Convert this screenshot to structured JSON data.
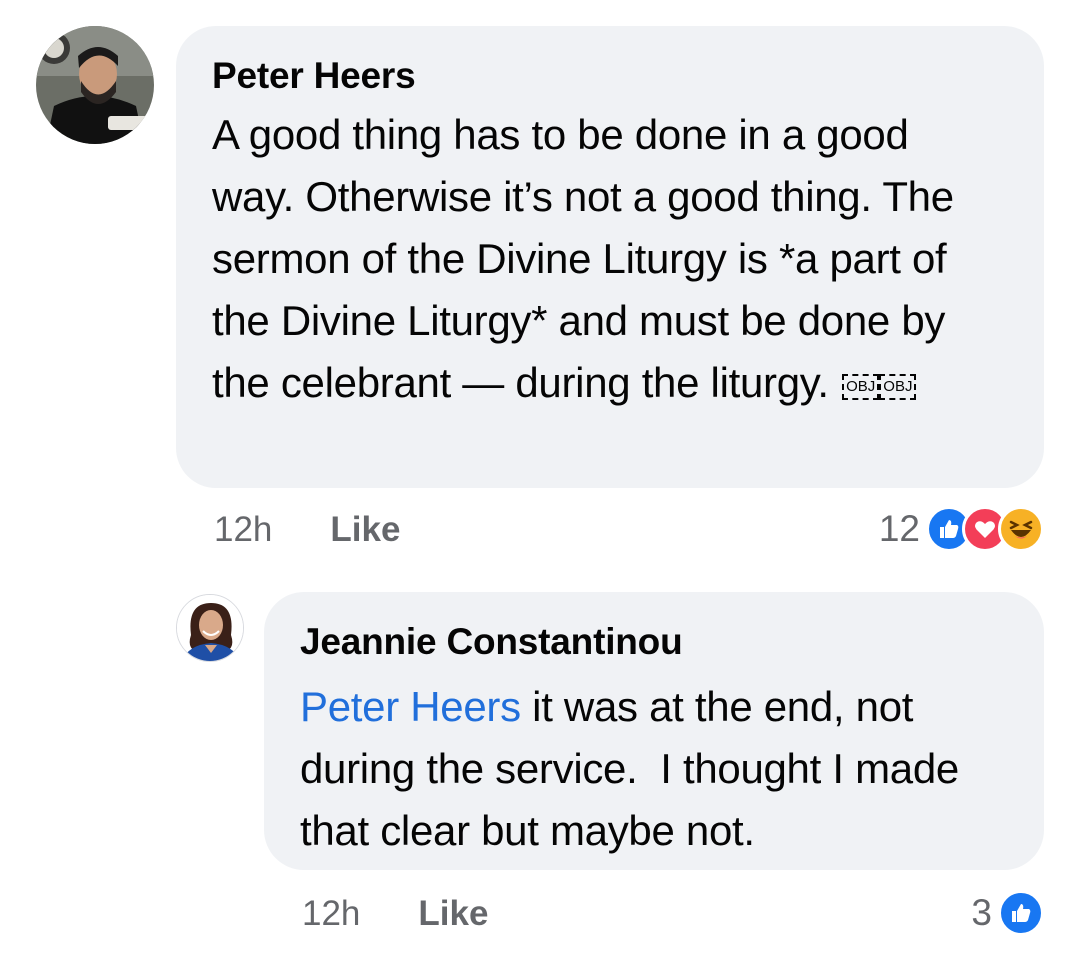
{
  "comments": [
    {
      "author": "Peter Heers",
      "text": "A good thing has to be done in a good way. Otherwise it’s not a good thing. The sermon of the Divine Liturgy is *a part of the Divine Liturgy* and must be done by the celebrant — during the liturgy.",
      "obj_placeholders": [
        "OBJ",
        "OBJ"
      ],
      "time": "12h",
      "like_label": "Like",
      "reaction_count": "12",
      "reactions": [
        "like-icon",
        "love-icon",
        "haha-icon"
      ]
    },
    {
      "author": "Jeannie Constantinou",
      "mention": "Peter Heers",
      "text": " it was at the end, not during the service.  I thought I made that clear but maybe not.",
      "time": "12h",
      "like_label": "Like",
      "reaction_count": "3",
      "reactions": [
        "like-icon"
      ]
    }
  ],
  "colors": {
    "bubble": "#f0f2f5",
    "mention": "#216fdb",
    "meta": "#65676b",
    "like_blue": "#1877f2",
    "love_red": "#f33e58",
    "haha_yellow": "#f7b125"
  }
}
